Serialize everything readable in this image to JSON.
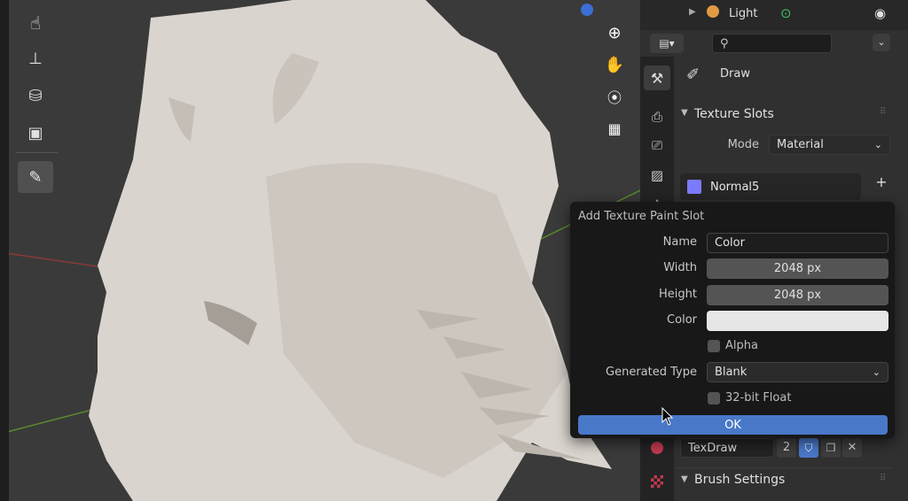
{
  "outliner": {
    "item_label": "Light"
  },
  "properties": {
    "search": {
      "placeholder": ""
    },
    "tool_name": "Draw",
    "texture_slots": {
      "header": "Texture Slots",
      "mode_label": "Mode",
      "mode_value": "Material",
      "slot_name": "Normal5"
    },
    "brush_texture": {
      "name": "TexDraw",
      "users": "2"
    },
    "brush_settings_header": "Brush Settings"
  },
  "dialog": {
    "title": "Add Texture Paint Slot",
    "name_label": "Name",
    "name_value": "Color",
    "width_label": "Width",
    "width_value": "2048 px",
    "height_label": "Height",
    "height_value": "2048 px",
    "color_label": "Color",
    "color_value": "#e6e6e6",
    "alpha_label": "Alpha",
    "gen_type_label": "Generated Type",
    "gen_type_value": "Blank",
    "float_label": "32-bit Float",
    "ok_label": "OK"
  },
  "colors": {
    "accent": "#4a78c9",
    "slot_swatch": "#7b7bff",
    "selection_dot": "#3b6fd6"
  }
}
